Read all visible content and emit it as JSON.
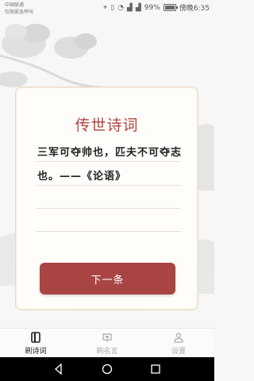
{
  "status_bar": {
    "carrier_line1": "中国联通",
    "carrier_line2": "仅限紧急呼叫",
    "battery_percent": "99%",
    "battery_level": 0.99,
    "time": "傍晚6:35"
  },
  "card": {
    "title": "传世诗词",
    "lines": [
      "三军可夺帅也，匹夫不可夺志",
      "也。——《论语》"
    ],
    "next_label": "下一条"
  },
  "tabs": [
    {
      "label": "刷诗词",
      "icon": "book-icon",
      "active": true
    },
    {
      "label": "刷名言",
      "icon": "quote-heart-icon",
      "active": false
    },
    {
      "label": "设置",
      "icon": "person-icon",
      "active": false
    }
  ],
  "nav": {
    "back": "back-icon",
    "home": "home-icon",
    "recent": "recent-apps-icon"
  },
  "colors": {
    "accent": "#b2443f",
    "button": "#a84542"
  }
}
